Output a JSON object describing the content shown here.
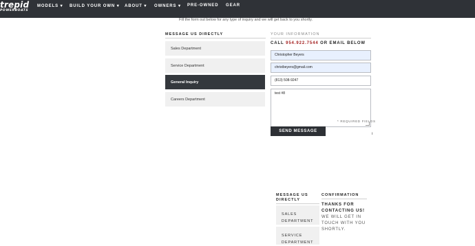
{
  "nav": {
    "logo_main": "trepid",
    "logo_sub": "POWERBOATS",
    "items": [
      "MODELS ▾",
      "BUILD YOUR OWN ▾",
      "ABOUT ▾",
      "OWNERS ▾",
      "PRE-OWNED",
      "GEAR"
    ]
  },
  "subtitle": "Fill the form out below for any type of inquiry and we will get back to you shortly.",
  "message_section": {
    "title": "MESSAGE US DIRECTLY",
    "tabs": [
      "Sales Department",
      "Service Department",
      "General Inquiry",
      "Careers Department"
    ],
    "active_tab": "General Inquiry"
  },
  "info_section": {
    "title": "YOUR INFORMATION",
    "call_prefix": "CALL",
    "phone": "954.922.7544",
    "call_suffix": "OR EMAIL BELOW",
    "fields": {
      "name": "Christopher Beyers",
      "email": "christbeyers@gmail.com",
      "phone": "(813) 508-9247",
      "message": "test #8"
    },
    "required_note": "* REQUIRED FIELDS",
    "send_label": "SEND MESSAGE"
  },
  "mobile": {
    "title": "MESSAGE US DIRECTLY",
    "tabs": [
      "SALES DEPARTMENT",
      "SERVICE DEPARTMENT"
    ],
    "confirm_title": "CONFIRMATION",
    "confirm_bold": "THANKS FOR CONTACTING US!",
    "confirm_text": "WE WILL GET IN TOUCH WITH YOU SHORTLY."
  },
  "colors": {
    "nav_bg": "#2f3237",
    "active_tab": "#34383d",
    "phone_accent": "#a11a1a",
    "autofill_bg": "#e8f0fe"
  }
}
